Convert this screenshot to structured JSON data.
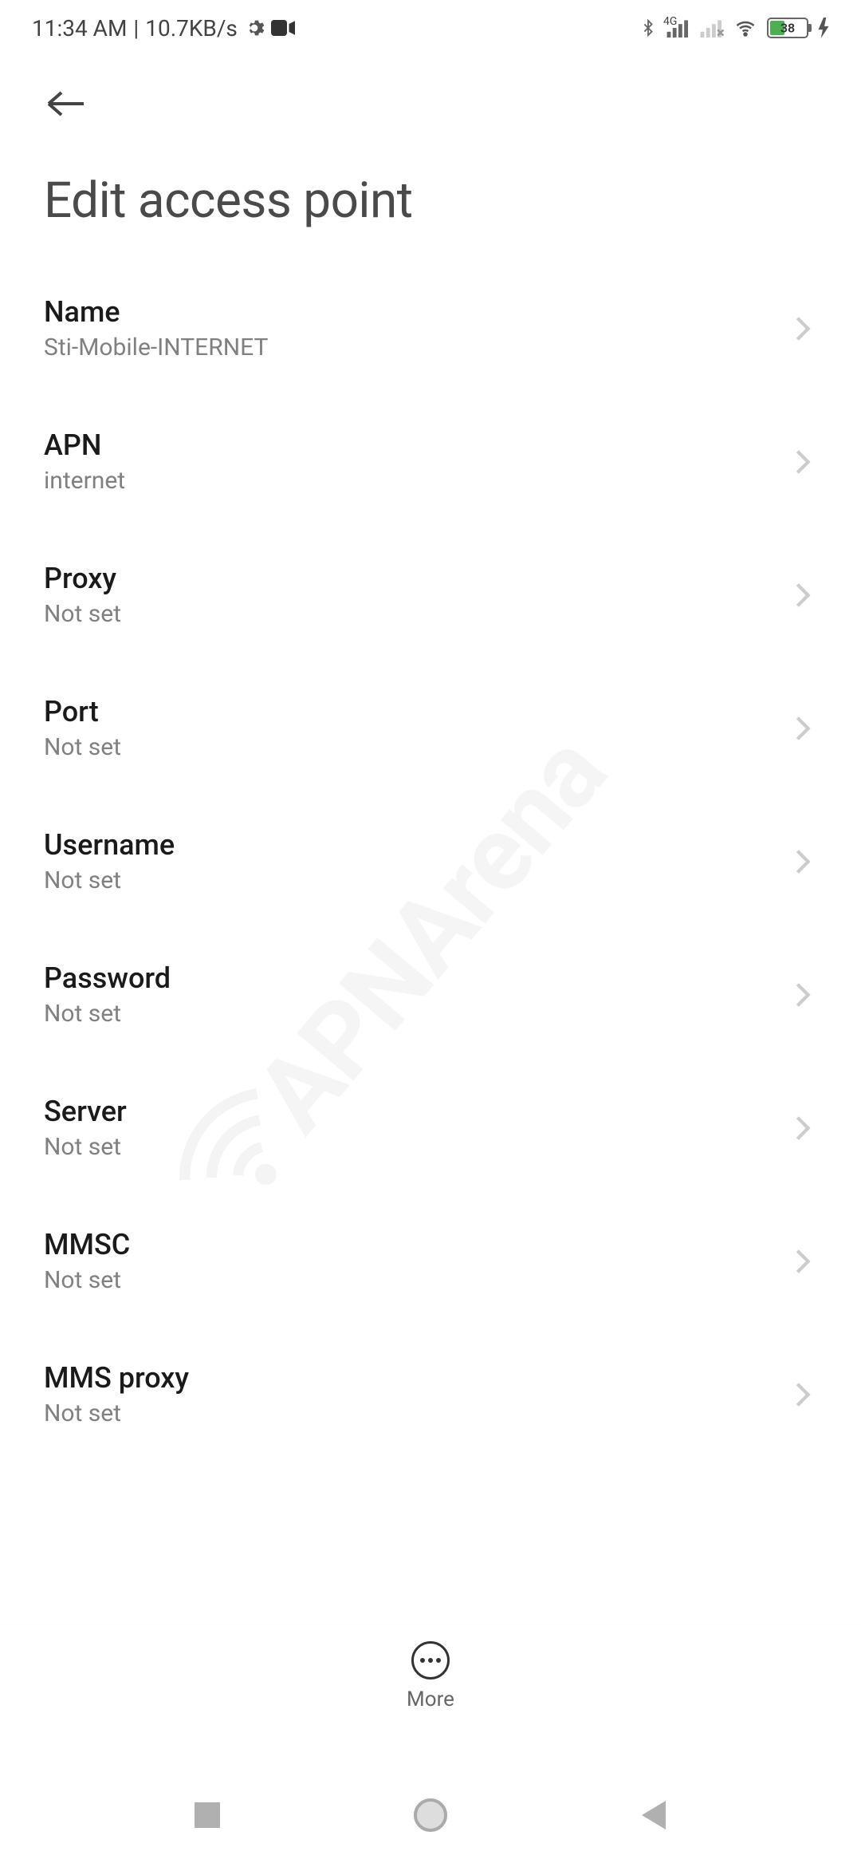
{
  "status_bar": {
    "time": "11:34 AM",
    "data_rate": "10.7KB/s",
    "network_type": "4G",
    "battery_percent": "38"
  },
  "page": {
    "title": "Edit access point"
  },
  "settings": [
    {
      "label": "Name",
      "value": "Sti-Mobile-INTERNET"
    },
    {
      "label": "APN",
      "value": "internet"
    },
    {
      "label": "Proxy",
      "value": "Not set"
    },
    {
      "label": "Port",
      "value": "Not set"
    },
    {
      "label": "Username",
      "value": "Not set"
    },
    {
      "label": "Password",
      "value": "Not set"
    },
    {
      "label": "Server",
      "value": "Not set"
    },
    {
      "label": "MMSC",
      "value": "Not set"
    },
    {
      "label": "MMS proxy",
      "value": "Not set"
    }
  ],
  "bottom_action": {
    "label": "More"
  },
  "watermark": "APNArena"
}
